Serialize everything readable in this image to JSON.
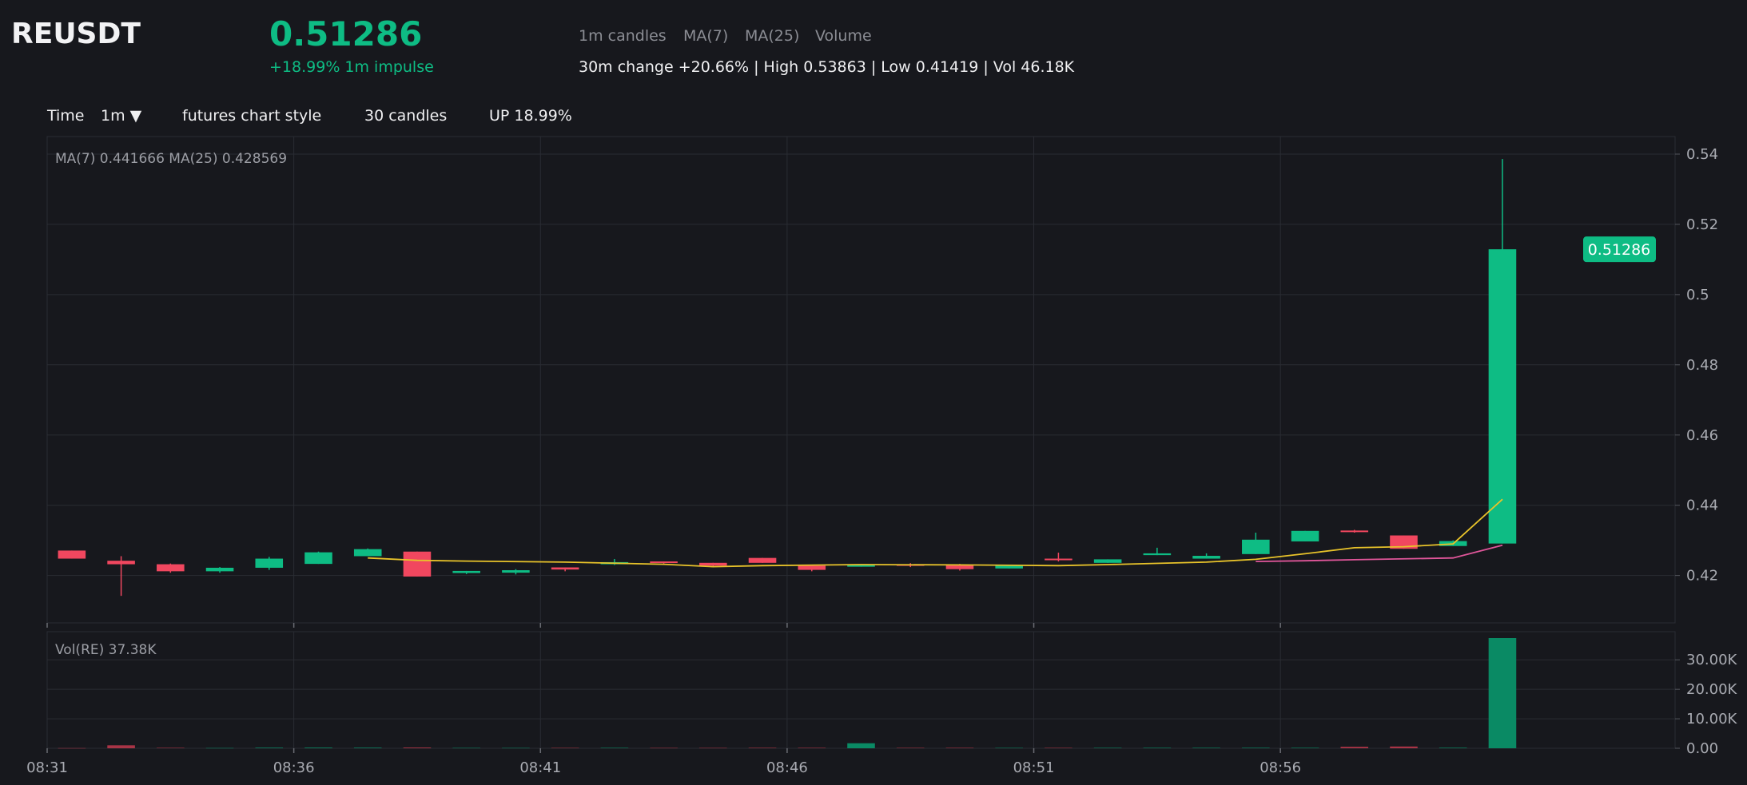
{
  "header": {
    "symbol": "REUSDT",
    "price": "0.51286",
    "change": "+18.99% 1m impulse",
    "indicators": [
      "1m candles",
      "MA(7)",
      "MA(25)",
      "Volume"
    ],
    "stats": "30m change +20.66% | High 0.53863 | Low 0.41419 | Vol 46.18K"
  },
  "toolbar": {
    "time_label": "Time",
    "interval": "1m ▼",
    "style": "futures chart style",
    "candles": "30 candles",
    "direction": "UP 18.99%"
  },
  "colors": {
    "up": "#0ebc84",
    "down": "#f1475f",
    "ma7": "#e8c32a",
    "ma25": "#e0569a",
    "vol_up": "#0a8a64",
    "vol_down": "#a83446",
    "grid": "#2a2c33",
    "background": "#17181d"
  },
  "chart_data": {
    "type": "candlestick",
    "price_legend": "MA(7) 0.441666    MA(25) 0.428569",
    "volume_legend": "Vol(RE) 37.38K",
    "last_price_tag": "0.51286",
    "price_ylim": [
      0.4065,
      0.545
    ],
    "price_ticks": [
      "0.42",
      "0.44",
      "0.46",
      "0.48",
      "0.5",
      "0.52",
      "0.54"
    ],
    "volume_ylim": [
      0,
      37380
    ],
    "volume_ticks": [
      "0.00",
      "10.00K",
      "20.00K",
      "30.00K"
    ],
    "x_range": [
      0,
      33
    ],
    "x_ticks": [
      {
        "at": 0,
        "label": "08:31"
      },
      {
        "at": 5,
        "label": "08:36"
      },
      {
        "at": 10,
        "label": "08:41"
      },
      {
        "at": 15,
        "label": "08:46"
      },
      {
        "at": 20,
        "label": "08:51"
      },
      {
        "at": 25,
        "label": "08:56"
      }
    ],
    "candles": [
      {
        "t": "08:31",
        "o": 0.4271,
        "h": 0.4271,
        "l": 0.4248,
        "c": 0.4248,
        "v": 60
      },
      {
        "t": "08:32",
        "o": 0.4242,
        "h": 0.4255,
        "l": 0.4142,
        "c": 0.4232,
        "v": 1000
      },
      {
        "t": "08:33",
        "o": 0.4232,
        "h": 0.4234,
        "l": 0.4208,
        "c": 0.4212,
        "v": 150
      },
      {
        "t": "08:34",
        "o": 0.4212,
        "h": 0.4224,
        "l": 0.4208,
        "c": 0.4222,
        "v": 90
      },
      {
        "t": "08:35",
        "o": 0.4222,
        "h": 0.4253,
        "l": 0.4216,
        "c": 0.4248,
        "v": 200
      },
      {
        "t": "08:36",
        "o": 0.4233,
        "h": 0.4268,
        "l": 0.4233,
        "c": 0.4266,
        "v": 220
      },
      {
        "t": "08:37",
        "o": 0.4255,
        "h": 0.4277,
        "l": 0.4255,
        "c": 0.4275,
        "v": 200
      },
      {
        "t": "08:38",
        "o": 0.4268,
        "h": 0.4268,
        "l": 0.4197,
        "c": 0.4197,
        "v": 250
      },
      {
        "t": "08:39",
        "o": 0.4207,
        "h": 0.4213,
        "l": 0.4204,
        "c": 0.4213,
        "v": 120
      },
      {
        "t": "08:40",
        "o": 0.4208,
        "h": 0.4218,
        "l": 0.4203,
        "c": 0.4215,
        "v": 110
      },
      {
        "t": "08:41",
        "o": 0.4223,
        "h": 0.4223,
        "l": 0.4212,
        "c": 0.4217,
        "v": 130
      },
      {
        "t": "08:42",
        "o": 0.4232,
        "h": 0.4247,
        "l": 0.423,
        "c": 0.4238,
        "v": 150
      },
      {
        "t": "08:43",
        "o": 0.424,
        "h": 0.424,
        "l": 0.4234,
        "c": 0.4236,
        "v": 120
      },
      {
        "t": "08:44",
        "o": 0.4236,
        "h": 0.4236,
        "l": 0.4225,
        "c": 0.4228,
        "v": 120
      },
      {
        "t": "08:45",
        "o": 0.425,
        "h": 0.425,
        "l": 0.4236,
        "c": 0.4236,
        "v": 160
      },
      {
        "t": "08:46",
        "o": 0.4228,
        "h": 0.4228,
        "l": 0.4212,
        "c": 0.4216,
        "v": 150
      },
      {
        "t": "08:47",
        "o": 0.4225,
        "h": 0.4232,
        "l": 0.4225,
        "c": 0.4231,
        "v": 1700
      },
      {
        "t": "08:48",
        "o": 0.4232,
        "h": 0.4235,
        "l": 0.4224,
        "c": 0.4228,
        "v": 140
      },
      {
        "t": "08:49",
        "o": 0.4229,
        "h": 0.4233,
        "l": 0.4214,
        "c": 0.4218,
        "v": 150
      },
      {
        "t": "08:50",
        "o": 0.422,
        "h": 0.4231,
        "l": 0.422,
        "c": 0.4228,
        "v": 130
      },
      {
        "t": "08:51",
        "o": 0.4248,
        "h": 0.4265,
        "l": 0.424,
        "c": 0.4245,
        "v": 140
      },
      {
        "t": "08:52",
        "o": 0.4236,
        "h": 0.4246,
        "l": 0.4236,
        "c": 0.4246,
        "v": 150
      },
      {
        "t": "08:53",
        "o": 0.4258,
        "h": 0.4279,
        "l": 0.4258,
        "c": 0.4263,
        "v": 160
      },
      {
        "t": "08:54",
        "o": 0.4248,
        "h": 0.4263,
        "l": 0.4248,
        "c": 0.4256,
        "v": 160
      },
      {
        "t": "08:55",
        "o": 0.4261,
        "h": 0.4322,
        "l": 0.4261,
        "c": 0.4302,
        "v": 170
      },
      {
        "t": "08:56",
        "o": 0.4297,
        "h": 0.4327,
        "l": 0.4297,
        "c": 0.4327,
        "v": 160
      },
      {
        "t": "08:57",
        "o": 0.4328,
        "h": 0.433,
        "l": 0.4322,
        "c": 0.4325,
        "v": 500
      },
      {
        "t": "08:58",
        "o": 0.4314,
        "h": 0.4314,
        "l": 0.4276,
        "c": 0.4276,
        "v": 600
      },
      {
        "t": "08:59",
        "o": 0.4284,
        "h": 0.43,
        "l": 0.4284,
        "c": 0.4298,
        "v": 180
      },
      {
        "t": "09:00",
        "o": 0.4291,
        "h": 0.5386,
        "l": 0.4291,
        "c": 0.5129,
        "v": 37380
      }
    ],
    "ma7": [
      [
        6,
        0.425
      ],
      [
        7,
        0.4243
      ],
      [
        8,
        0.4241
      ],
      [
        10,
        0.4238
      ],
      [
        12,
        0.4232
      ],
      [
        13,
        0.4225
      ],
      [
        14,
        0.4228
      ],
      [
        16,
        0.4231
      ],
      [
        18,
        0.423
      ],
      [
        20,
        0.4228
      ],
      [
        21,
        0.4231
      ],
      [
        23,
        0.4238
      ],
      [
        24,
        0.4246
      ],
      [
        25,
        0.4262
      ],
      [
        26,
        0.4279
      ],
      [
        27,
        0.4282
      ],
      [
        28,
        0.429
      ],
      [
        29,
        0.4417
      ]
    ],
    "ma25": [
      [
        24,
        0.424
      ],
      [
        25,
        0.4242
      ],
      [
        26,
        0.4245
      ],
      [
        28,
        0.425
      ],
      [
        29,
        0.4286
      ]
    ]
  }
}
